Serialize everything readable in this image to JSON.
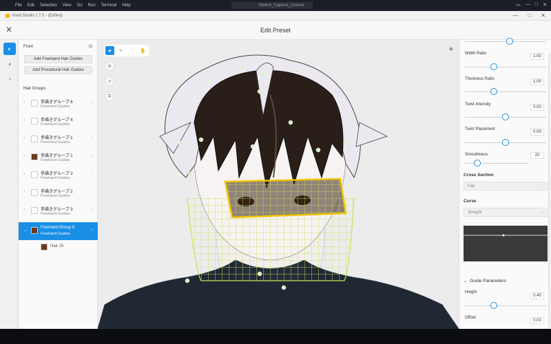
{
  "os": {
    "menu": [
      "File",
      "Edit",
      "Selection",
      "View",
      "Go",
      "Run",
      "Terminal",
      "Help"
    ],
    "search": "Motion_Capture_Course"
  },
  "app": {
    "title": "Vroid Studio 1.7.0 - (Edited)"
  },
  "dialog": {
    "title": "Edit Preset"
  },
  "left_panel": {
    "section": "Front",
    "btn_freehand": "Add Freehand Hair Guides",
    "btn_procedural": "Add Procedural Hair Guides",
    "groups_label": "Hair Groups",
    "groups": [
      {
        "name": "手描きグループ 6",
        "sub": "Freehand Guides",
        "swatch": "#ffffff"
      },
      {
        "name": "手描きグループ 4",
        "sub": "Freehand Guides",
        "swatch": "#ffffff"
      },
      {
        "name": "手描きグループ 1",
        "sub": "Freehand Guides",
        "swatch": "#ffffff"
      },
      {
        "name": "手描きグループ 1",
        "sub": "Freehand Guides",
        "swatch": "#6b3b22"
      },
      {
        "name": "手描きグループ 2",
        "sub": "Freehand Guides",
        "swatch": "#ffffff"
      },
      {
        "name": "手描きグループ 2",
        "sub": "Freehand Guides",
        "swatch": "#ffffff"
      },
      {
        "name": "手描きグループ 3",
        "sub": "Freehand Guides",
        "swatch": "#ffffff"
      },
      {
        "name": "Freehand Group 8",
        "sub": "Freehand Guides",
        "swatch": "#6b3b22",
        "selected": true
      }
    ],
    "child": {
      "name": "Hair 25"
    }
  },
  "right_panel": {
    "params": [
      {
        "label": "Width Ratio",
        "value": "1.00",
        "level": 0.36
      },
      {
        "label": "Thickness Ratio",
        "value": "1.00",
        "level": 0.36
      },
      {
        "label": "Twist Intensity",
        "value": "0.00",
        "level": 0.5
      },
      {
        "label": "Twist Placement",
        "value": "0.00",
        "level": 0.5
      },
      {
        "label": "Smoothness",
        "value": "20",
        "level": 0.2
      }
    ],
    "cross_section": {
      "label": "Cross Section",
      "value": "Flat"
    },
    "curve": {
      "label": "Curve",
      "value": "Straight"
    },
    "guide_params": {
      "label": "Guide Parameters"
    },
    "height": {
      "label": "Height",
      "value": "0.40",
      "level": 0.36
    },
    "offset": {
      "label": "Offset",
      "value": "0.03"
    }
  },
  "colors": {
    "accent": "#1a8fe6",
    "mesh": "#c9e25a",
    "hair_dark": "#2a1f18",
    "hair_light": "#ece8ef"
  }
}
